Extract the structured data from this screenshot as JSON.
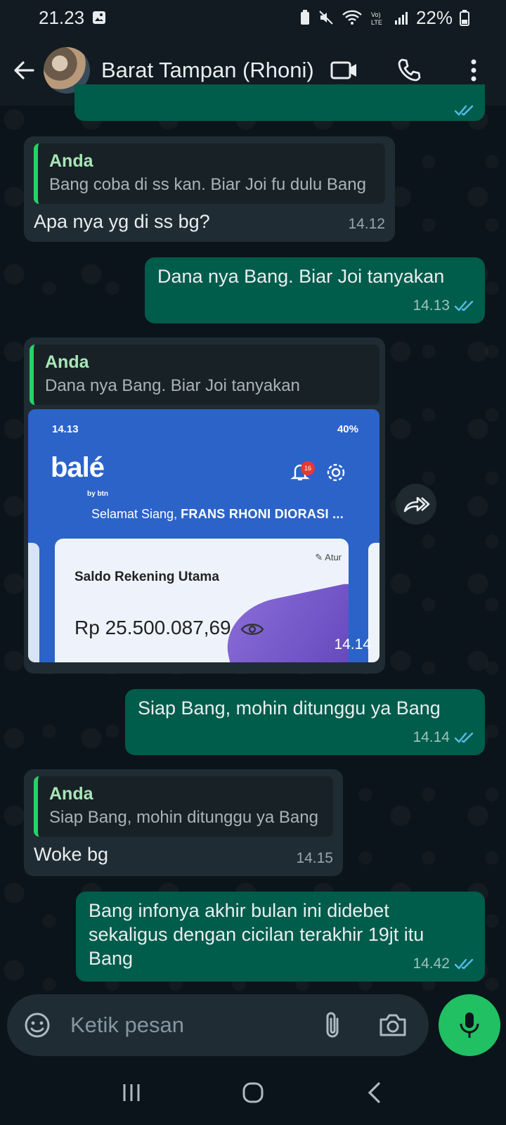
{
  "status_bar": {
    "time": "21.23",
    "battery": "22%"
  },
  "header": {
    "contact_name": "Barat Tampan (Rhoni)"
  },
  "messages": [
    {
      "direction": "in",
      "quote_author": "Anda",
      "quote_text": "Bang coba di ss kan. Biar Joi fu dulu Bang",
      "text": "Apa nya yg di ss bg?",
      "time": "14.12"
    },
    {
      "direction": "out",
      "text": "Dana nya Bang. Biar Joi tanyakan",
      "time": "14.13",
      "status": "read"
    },
    {
      "direction": "in",
      "quote_author": "Anda",
      "quote_text": "Dana nya Bang. Biar Joi tanyakan",
      "time": "14.14",
      "image": {
        "status_time": "14.13",
        "status_battery": "40%",
        "logo": "balé",
        "logo_sub": "by btn",
        "badge_count": "16",
        "greeting": "Selamat Siang,",
        "greeting_name": "FRANS RHONI DIORASI ...",
        "card_title": "Saldo Rekening Utama",
        "atur_label": "Atur",
        "amount": "Rp 25.500.087,69"
      }
    },
    {
      "direction": "out",
      "text": "Siap Bang, mohin ditunggu ya Bang",
      "time": "14.14",
      "status": "read"
    },
    {
      "direction": "in",
      "quote_author": "Anda",
      "quote_text": "Siap Bang, mohin ditunggu ya Bang",
      "text": "Woke bg",
      "time": "14.15"
    },
    {
      "direction": "out",
      "text_lines": [
        "Bang infonya akhir bulan ini  didebet",
        "sekaligus dengan cicilan terakhir 19jt itu",
        "Bang"
      ],
      "time": "14.42",
      "status": "read"
    }
  ],
  "composer": {
    "placeholder": "Ketik pesan"
  },
  "colors": {
    "background": "#0b141a",
    "incoming_bubble": "#202c33",
    "outgoing_bubble": "#005c4b",
    "accent": "#21c063",
    "read_ticks": "#53bdeb"
  }
}
